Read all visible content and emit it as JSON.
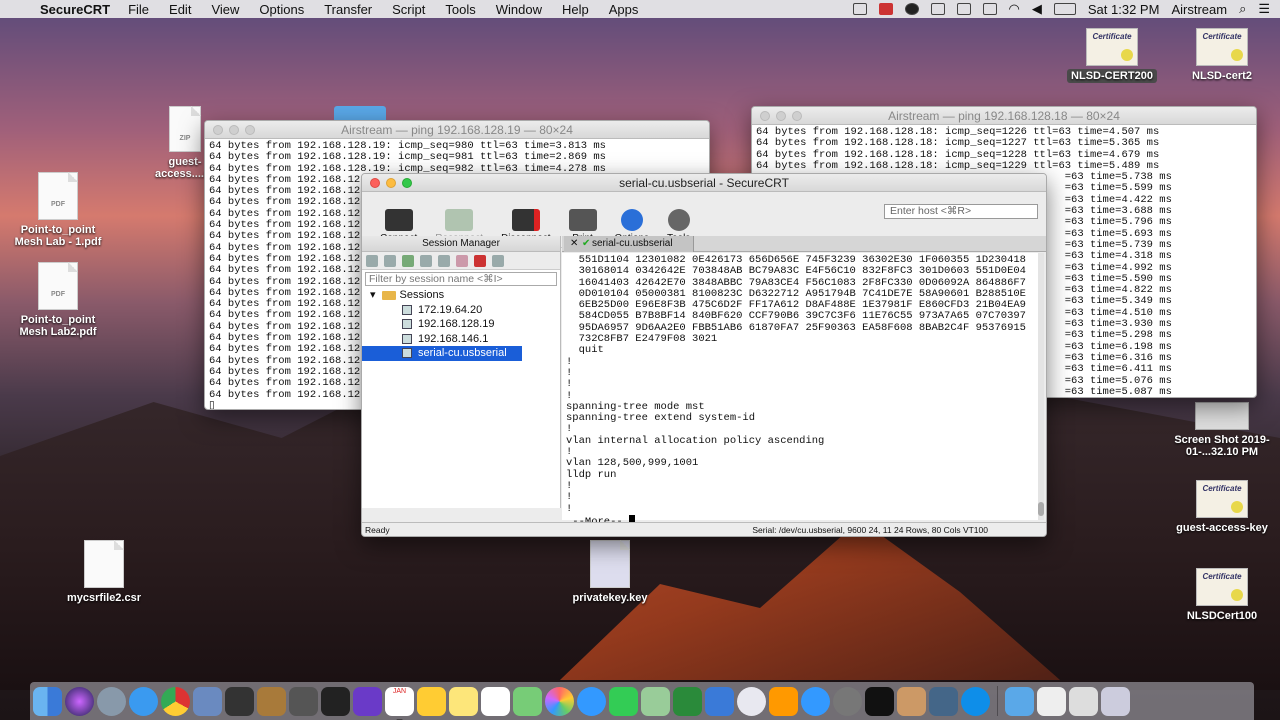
{
  "menubar": {
    "app": "SecureCRT",
    "items": [
      "File",
      "Edit",
      "View",
      "Options",
      "Transfer",
      "Script",
      "Tools",
      "Window",
      "Help",
      "Apps"
    ],
    "clock": "Sat 1:32 PM",
    "user": "Airstream"
  },
  "desktop": {
    "icons": [
      {
        "label": "guest-access....rg",
        "kind": "zip",
        "badge": "ZIP"
      },
      {
        "label": "Point-to_point Mesh Lab - 1.pdf",
        "kind": "pdf",
        "badge": "PDF"
      },
      {
        "label": "Point-to_point Mesh Lab2.pdf",
        "kind": "pdf",
        "badge": "PDF"
      },
      {
        "label": "mycsrfile2.csr",
        "kind": "doc"
      },
      {
        "label": "privatekey.key",
        "kind": "doc"
      },
      {
        "label": "NLSD-CERT200",
        "kind": "cert"
      },
      {
        "label": "NLSD-cert2",
        "kind": "cert"
      },
      {
        "label": "Screen Shot 2019-01-...32.10 PM",
        "kind": "screenshot"
      },
      {
        "label": "guest-access-key",
        "kind": "cert"
      },
      {
        "label": "NLSDCert100",
        "kind": "cert"
      }
    ],
    "cert_text": "Certificate"
  },
  "win_left": {
    "title": "Airstream — ping 192.168.128.19 — 80×24",
    "lines": [
      "64 bytes from 192.168.128.19: icmp_seq=980 ttl=63 time=3.813 ms",
      "64 bytes from 192.168.128.19: icmp_seq=981 ttl=63 time=2.869 ms",
      "64 bytes from 192.168.128.19: icmp_seq=982 ttl=63 time=4.278 ms",
      "64 bytes from 192.168.128",
      "64 bytes from 192.168.128",
      "64 bytes from 192.168.128",
      "64 bytes from 192.168.128",
      "64 bytes from 192.168.128",
      "64 bytes from 192.168.128",
      "64 bytes from 192.168.128",
      "64 bytes from 192.168.128",
      "64 bytes from 192.168.128",
      "64 bytes from 192.168.128",
      "64 bytes from 192.168.128",
      "64 bytes from 192.168.128",
      "64 bytes from 192.168.128",
      "64 bytes from 192.168.128",
      "64 bytes from 192.168.128",
      "64 bytes from 192.168.128",
      "64 bytes from 192.168.128",
      "64 bytes from 192.168.128",
      "64 bytes from 192.168.128",
      "64 bytes from 192.168.128",
      "▯"
    ]
  },
  "win_right": {
    "title": "Airstream — ping 192.168.128.18 — 80×24",
    "lines": [
      "64 bytes from 192.168.128.18: icmp_seq=1226 ttl=63 time=4.507 ms",
      "64 bytes from 192.168.128.18: icmp_seq=1227 ttl=63 time=5.365 ms",
      "64 bytes from 192.168.128.18: icmp_seq=1228 ttl=63 time=4.679 ms",
      "64 bytes from 192.168.128.18: icmp_seq=1229 ttl=63 time=5.489 ms",
      "                                                 =63 time=5.738 ms",
      "                                                 =63 time=5.599 ms",
      "                                                 =63 time=4.422 ms",
      "                                                 =63 time=3.688 ms",
      "                                                 =63 time=5.796 ms",
      "                                                 =63 time=5.693 ms",
      "                                                 =63 time=5.739 ms",
      "                                                 =63 time=4.318 ms",
      "                                                 =63 time=4.992 ms",
      "                                                 =63 time=5.590 ms",
      "                                                 =63 time=4.822 ms",
      "                                                 =63 time=5.349 ms",
      "                                                 =63 time=4.510 ms",
      "                                                 =63 time=3.930 ms",
      "                                                 =63 time=5.298 ms",
      "                                                 =63 time=6.198 ms",
      "                                                 =63 time=6.316 ms",
      "                                                 =63 time=6.411 ms",
      "                                                 =63 time=5.076 ms",
      "                                                 =63 time=5.087 ms"
    ]
  },
  "crt": {
    "title": "serial-cu.usbserial - SecureCRT",
    "toolbar": {
      "connect": "Connect",
      "reconnect": "Reconnect",
      "disconnect": "Disconnect",
      "print": "Print",
      "options": "Options",
      "tools": "Tools"
    },
    "host_placeholder": "Enter host <⌘R>",
    "session_manager": {
      "title": "Session Manager",
      "filter_placeholder": "Filter by session name <⌘I>",
      "folder": "Sessions",
      "sessions": [
        "172.19.64.20",
        "192.168.128.19",
        "192.168.146.1",
        "serial-cu.usbserial"
      ]
    },
    "tab_label": "serial-cu.usbserial",
    "terminal": [
      "  551D1104 12301082 0E426173 656D656E 745F3239 36302E30 1F060355 1D230418",
      "  30168014 0342642E 703848AB BC79A83C E4F56C10 832F8FC3 301D0603 551D0E04",
      "  16041403 42642E70 3848ABBC 79A83CE4 F56C1083 2F8FC330 0D06092A 864886F7",
      "  0D010104 05000381 8100823C D6322712 A951794B 7C41DE7E 58A90601 B288510E",
      "  6EB25D00 E96E8F3B 475C6D2F FF17A612 D8AF488E 1E37981F E860CFD3 21B04EA9",
      "  584CD055 B7B8BF14 840BF620 CCF790B6 39C7C3F6 11E76C55 973A7A65 07C70397",
      "  95DA6957 9D6AA2E0 FBB51AB6 61870FA7 25F90363 EA58F608 8BAB2C4F 95376915",
      "  732C8FB7 E2479F08 3021",
      "  quit",
      "!",
      "!",
      "!",
      "!",
      "spanning-tree mode mst",
      "spanning-tree extend system-id",
      "!",
      "vlan internal allocation policy ascending",
      "!",
      "vlan 128,500,999,1001",
      "lldp run",
      "!",
      "!",
      "!",
      " --More-- "
    ],
    "status_left": "Ready",
    "status_right": "Serial: /dev/cu.usbserial, 9600   24, 11   24 Rows, 80 Cols   VT100"
  },
  "dock": {
    "calendar_month": "JAN",
    "calendar_day": "5"
  }
}
